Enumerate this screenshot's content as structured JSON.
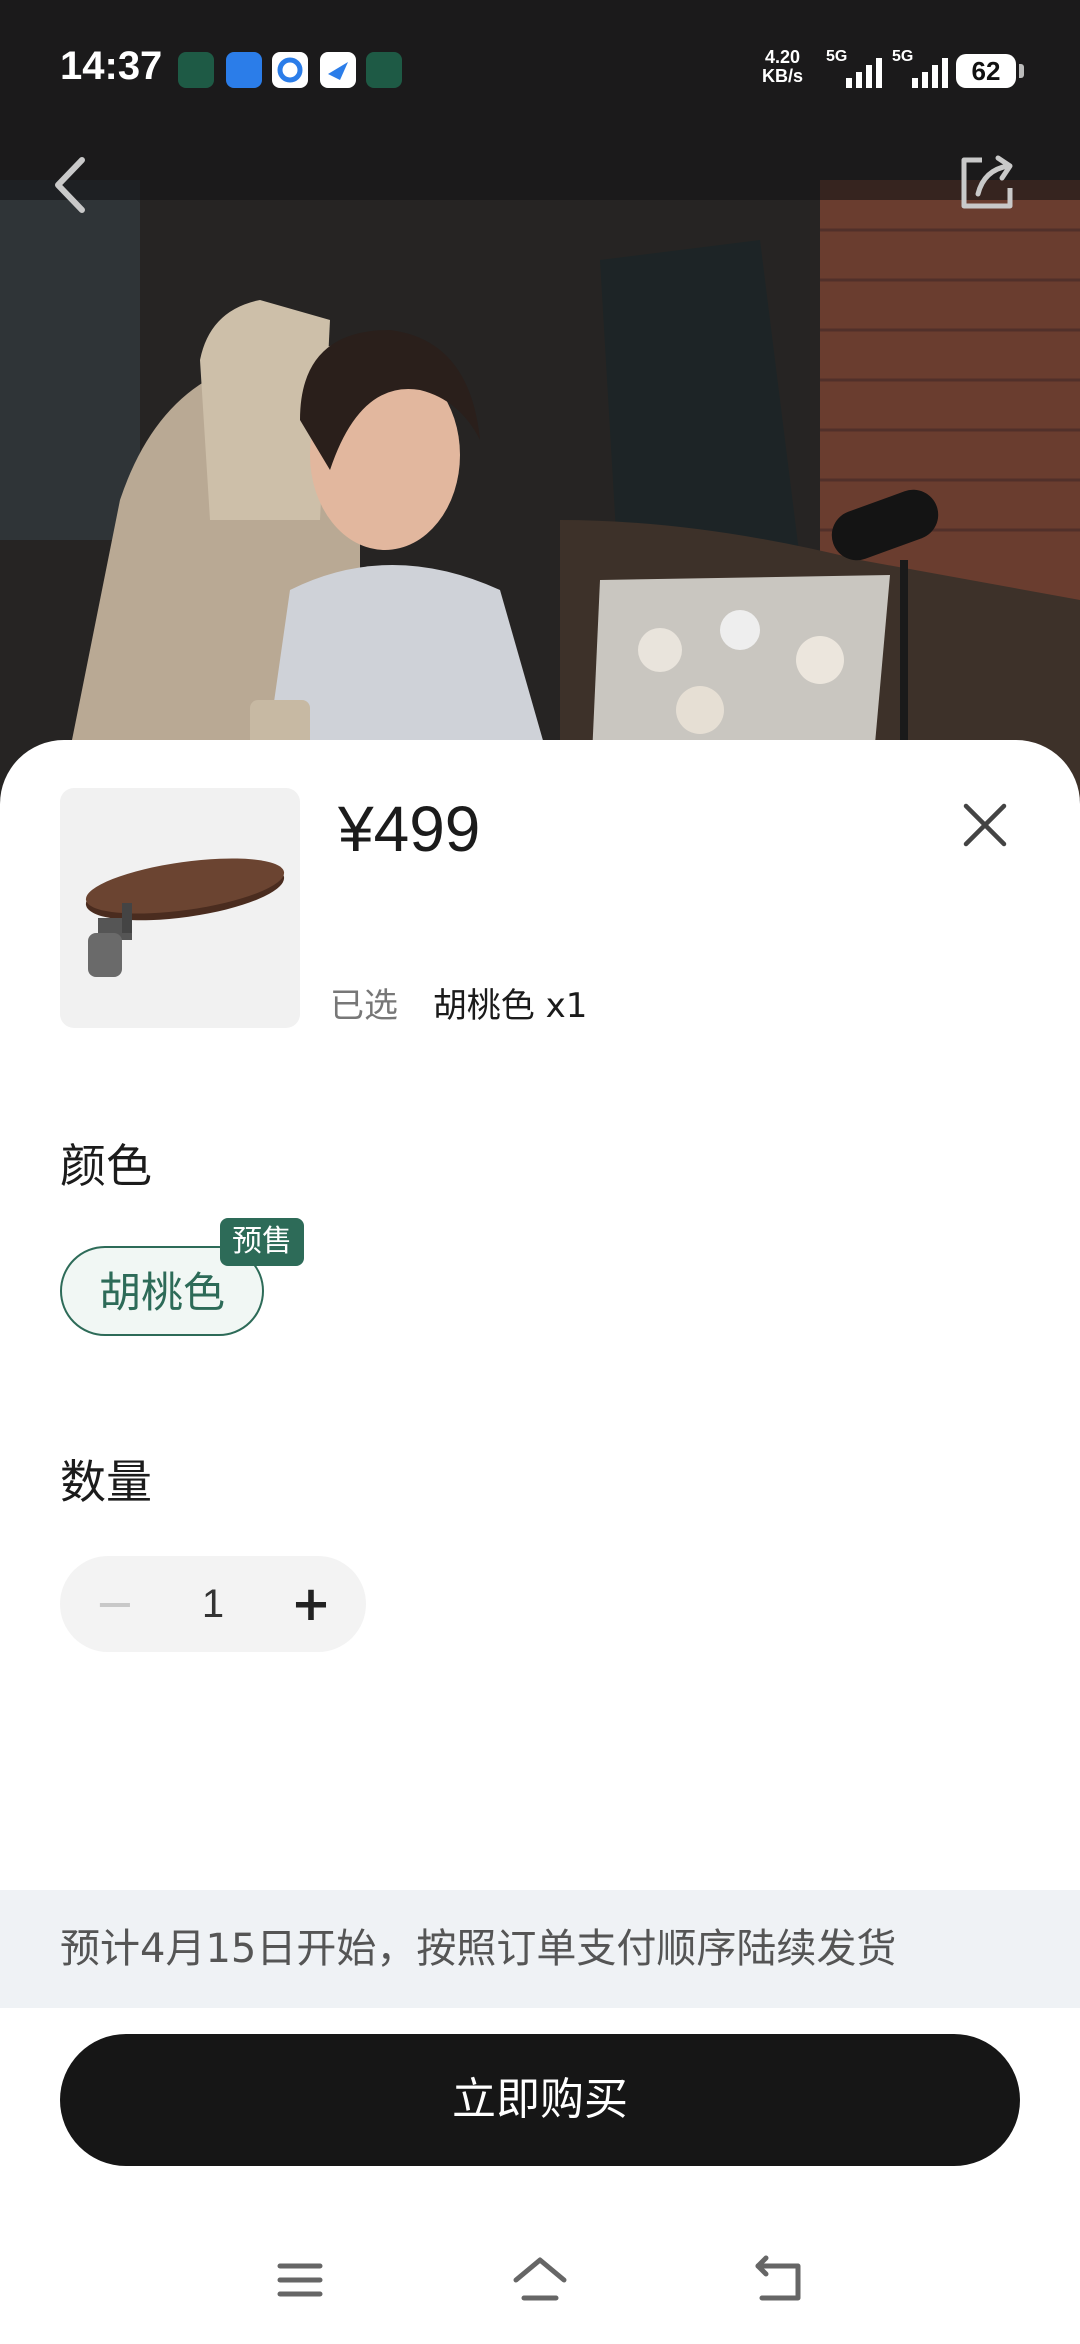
{
  "status_bar": {
    "time": "14:37",
    "net_speed_value": "4.20",
    "net_speed_unit": "KB/s",
    "sim1": "5G",
    "sim2": "5G",
    "battery": "62"
  },
  "product": {
    "price": "¥499",
    "selected_label": "已选",
    "selected_value": "胡桃色 x1"
  },
  "color_section": {
    "title": "颜色",
    "options": [
      {
        "label": "胡桃色",
        "badge": "预售",
        "selected": true
      }
    ]
  },
  "quantity_section": {
    "title": "数量",
    "minus": "−",
    "value": "1",
    "plus": "+"
  },
  "shipping_note": "预计4月15日开始，按照订单支付顺序陆续发货",
  "buy_button": "立即购买",
  "colors": {
    "accent": "#2d6b58",
    "button_bg": "#161616",
    "note_bg": "#eff2f5"
  },
  "icons": [
    "back-icon",
    "share-icon",
    "close-icon",
    "menu-icon",
    "home-icon",
    "return-icon"
  ]
}
